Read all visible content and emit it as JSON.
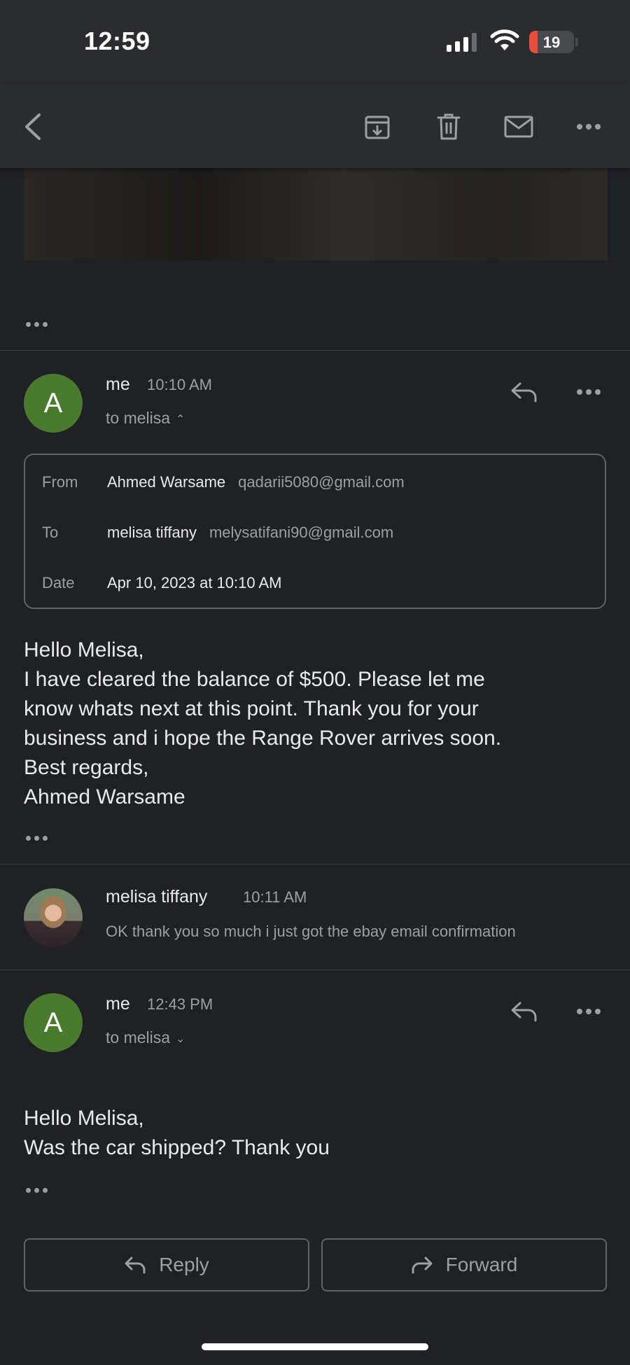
{
  "status_bar": {
    "time": "12:59",
    "battery": "19"
  },
  "toolbar": {
    "back": "back-icon",
    "archive": "archive-icon",
    "delete": "trash-icon",
    "mark_unread": "mail-icon",
    "more": "more-icon"
  },
  "messages": [
    {
      "sender": "me",
      "time": "10:10 AM",
      "avatar_letter": "A",
      "recipient_line": "to melisa",
      "details": {
        "from_label": "From",
        "from_name": "Ahmed Warsame",
        "from_email": "qadarii5080@gmail.com",
        "to_label": "To",
        "to_name": "melisa tiffany",
        "to_email": "melysatifani90@gmail.com",
        "date_label": "Date",
        "date_value": "Apr 10, 2023 at 10:10 AM"
      },
      "body": [
        "Hello Melisa,",
        "I have cleared the balance of $500. Please let me",
        "know whats next at this point. Thank you for your",
        "business and i hope the Range Rover arrives soon.",
        "Best regards,",
        "Ahmed Warsame"
      ]
    },
    {
      "sender": "melisa tiffany",
      "time": "10:11 AM",
      "snippet": "OK thank you so much i just got the ebay email confirmation"
    },
    {
      "sender": "me",
      "time": "12:43 PM",
      "avatar_letter": "A",
      "recipient_line": "to melisa",
      "body": [
        "Hello Melisa,",
        "Was the car shipped? Thank you"
      ]
    }
  ],
  "actions": {
    "reply": "Reply",
    "forward": "Forward"
  },
  "colors": {
    "background": "#202124",
    "avatar": "#4a7a2e",
    "battery_low": "#eb4e3d"
  }
}
